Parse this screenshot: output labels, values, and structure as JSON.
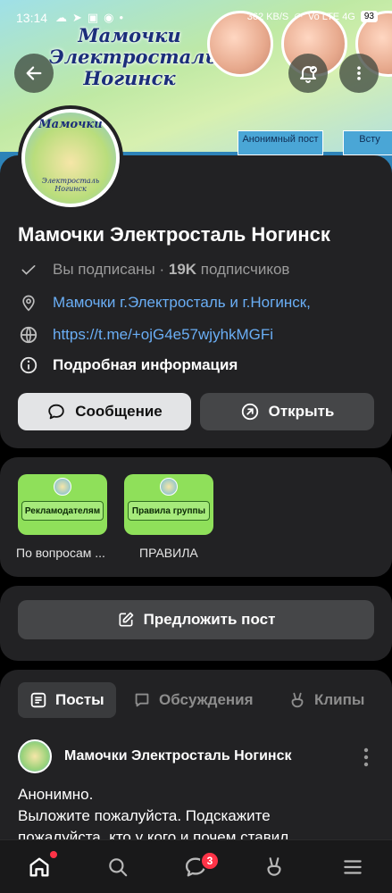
{
  "status_bar": {
    "time": "13:14",
    "speed": "362 KB/S",
    "network": "Vo LTE 4G",
    "battery": "93"
  },
  "cover": {
    "title_line1": "Мамочки",
    "title_line2": "Электросталь",
    "title_line3": "Ногинск",
    "tag_left": "Анонимный пост",
    "tag_right": "Всту"
  },
  "avatar": {
    "text_top": "Мамочки",
    "text_bottom": "Электросталь Ногинск"
  },
  "group": {
    "name": "Мамочки Электросталь Ногинск",
    "subscribed_label": "Вы подписаны",
    "separator": " · ",
    "subscribers_count": "19K",
    "subscribers_label": " подписчиков",
    "description": "Мамочки г.Электросталь и г.Ногинск,",
    "link": "https://t.me/+ojG4e57wjyhkMGFi",
    "details_label": "Подробная информация"
  },
  "actions": {
    "message": "Сообщение",
    "open": "Открыть",
    "suggest": "Предложить пост"
  },
  "links": [
    {
      "tile_text": "Рекламодателям",
      "caption": "По вопросам ..."
    },
    {
      "tile_text": "Правила группы",
      "caption": "ПРАВИЛА"
    }
  ],
  "tabs": {
    "posts": "Посты",
    "discussions": "Обсуждения",
    "clips": "Клипы"
  },
  "post": {
    "author": "Мамочки Электросталь Ногинск",
    "line1": "Анонимно.",
    "line2": "Выложите пожалуйста. Подскажите",
    "line3": "пожалуйста, кто у кого и почем ставил"
  },
  "nav": {
    "messages_badge": "3"
  },
  "colors": {
    "accent_link": "#6aaef5",
    "badge_red": "#ff3347",
    "tile_green": "#8fe05a"
  }
}
